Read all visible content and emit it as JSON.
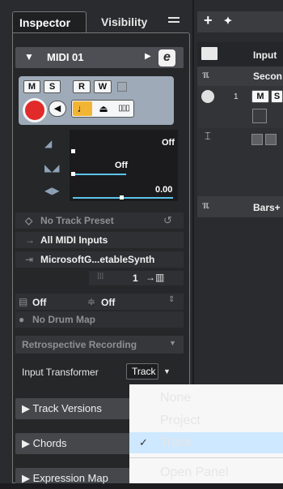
{
  "tabs": {
    "inspector": "Inspector",
    "visibility": "Visibility"
  },
  "track": {
    "name": "MIDI 01",
    "edit_icon": "e"
  },
  "buttons": {
    "mute": "M",
    "solo": "S",
    "read": "R",
    "write": "W"
  },
  "faders": {
    "volume_value": "Off",
    "pan_value": "Off",
    "delay_value": "0.00"
  },
  "info": {
    "preset": "No Track Preset",
    "input": "All MIDI Inputs",
    "output": "MicrosoftG...etableSynth",
    "channel": "1",
    "bank": "Off",
    "program": "Off",
    "drum_map": "No Drum Map",
    "retrospective": "Retrospective Recording",
    "input_transformer_label": "Input Transformer",
    "input_transformer_value": "Track"
  },
  "sections": [
    "Track Versions",
    "Chords",
    "Expression Map"
  ],
  "dropdown": {
    "items": [
      {
        "label": "None",
        "selected": false
      },
      {
        "label": "Project",
        "selected": false
      },
      {
        "label": "Track",
        "selected": true
      },
      {
        "label": "Open Panel",
        "selected": false
      }
    ]
  },
  "right_panel": {
    "rows": [
      {
        "label": "Input"
      },
      {
        "label": "Secon"
      },
      {
        "label": "Bars+"
      }
    ],
    "mini_buttons": {
      "mute": "M",
      "solo": "S",
      "track_number": "1"
    }
  },
  "colors": {
    "accent_timebase": "#f2b533",
    "record": "#e12a2a",
    "fader_line": "#5cc4ea",
    "selection": "#cde8ff"
  }
}
